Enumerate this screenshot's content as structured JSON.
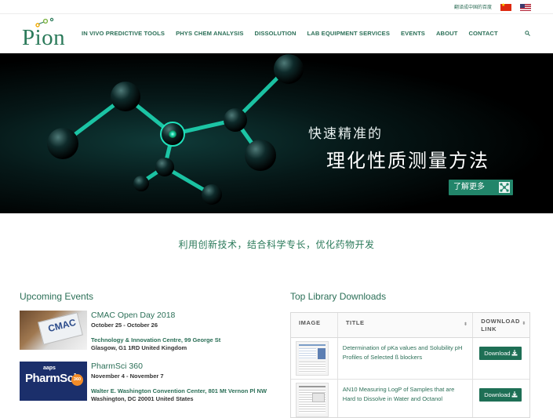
{
  "topbar": {
    "translate_link": "翻译成中国的百度",
    "flags": [
      "cn-flag-icon",
      "us-flag-icon"
    ]
  },
  "logo": {
    "text": "Pion"
  },
  "nav": {
    "items": [
      "IN VIVO PREDICTIVE TOOLS",
      "PHYS CHEM ANALYSIS",
      "DISSOLUTION",
      "LAB EQUIPMENT SERVICES",
      "EVENTS",
      "ABOUT",
      "CONTACT"
    ],
    "search_icon": "search-icon"
  },
  "hero": {
    "line1": "快速精准的",
    "line2": "理化性质测量方法",
    "button_label": "了解更多"
  },
  "tagline": "利用创新技术，结合科学专长，优化药物开发",
  "events": {
    "title": "Upcoming Events",
    "items": [
      {
        "thumb_text": "CMAC",
        "name": "CMAC Open Day 2018",
        "dates": "October 25 - October 26",
        "venue": "Technology & Innovation Centre, 99 George St",
        "address": "Glasgow, G1 1RD United Kingdom"
      },
      {
        "thumb_text": "PharmSci",
        "thumb_badge": "360",
        "thumb_brand": "aaps",
        "name": "PharmSci 360",
        "dates": "November 4 - November 7",
        "venue": "Walter E. Washington Convention Center, 801 Mt Vernon Pl NW",
        "address": "Washington, DC 20001 United States"
      }
    ]
  },
  "downloads": {
    "title": "Top Library Downloads",
    "columns": {
      "image": "IMAGE",
      "title": "TITLE",
      "download_line1": "DOWNLOAD",
      "download_line2": "LINK"
    },
    "rows": [
      {
        "title": "Determination of pKa values and Solubility pH Profiles of Selected ß blockers",
        "button": "Download"
      },
      {
        "title": "AN10 Measuring LogP of Samples that are Hard to Dissolve in Water and Octanol",
        "button": "Download"
      }
    ]
  }
}
